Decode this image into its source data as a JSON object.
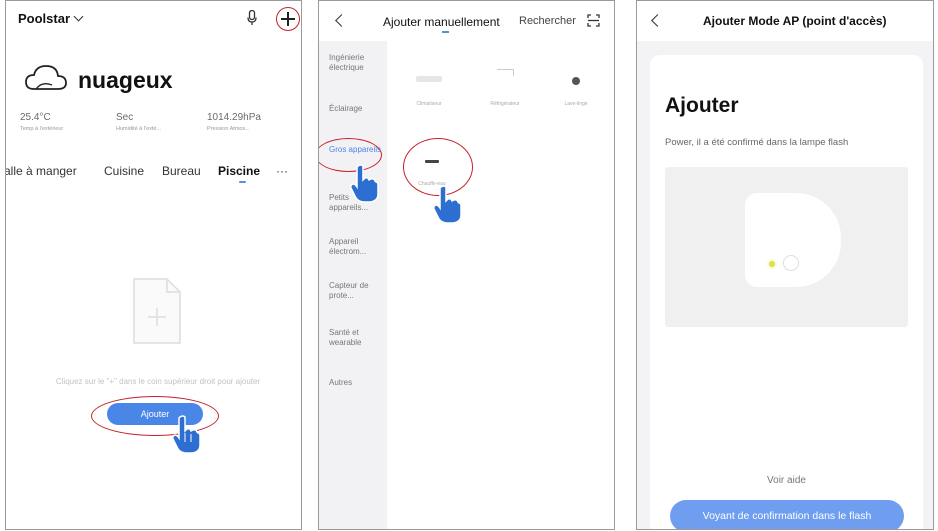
{
  "panel1": {
    "home_name": "Poolstar",
    "weather": {
      "condition": "nuageux",
      "temperature": "25.4°C",
      "temperature_label": "Temp à l'extérieur",
      "humidity": "Sec",
      "humidity_label": "Humidité à l'exté...",
      "pressure": "1014.29hPa",
      "pressure_label": "Pression Atmos..."
    },
    "rooms": [
      "alle à manger",
      "Cuisine",
      "Bureau",
      "Piscine"
    ],
    "active_room": "Piscine",
    "more": "···",
    "empty_hint": "Cliquez sur le \"+\" dans le coin supérieur droit pour ajouter",
    "add_button": "Ajouter"
  },
  "panel2": {
    "title": "Ajouter manuellement",
    "search": "Rechercher",
    "categories": [
      {
        "label": "Ingénierie électrique",
        "active": false
      },
      {
        "label": "Éclairage",
        "active": false
      },
      {
        "label": "Gros appareils",
        "active": true
      },
      {
        "label": "Petits appareils...",
        "active": false
      },
      {
        "label": "Appareil électrom...",
        "active": false
      },
      {
        "label": "Capteur de prote...",
        "active": false
      },
      {
        "label": "Santé et wearable",
        "active": false
      },
      {
        "label": "Autres",
        "active": false
      }
    ],
    "devices": [
      "Climatiseur",
      "Réfrigérateur",
      "Lave-linge",
      "Chauffe-eau"
    ]
  },
  "panel3": {
    "title": "Ajouter",
    "mode": "Mode AP (point d'accès)",
    "heading": "Ajouter",
    "subtitle": "Power, il a été confirmé dans la lampe flash",
    "help": "Voir aide",
    "confirm_button": "Voyant de confirmation dans le flash"
  },
  "colors": {
    "accent": "#4a85e8",
    "highlight_ring": "#c8202a",
    "led": "#d8e24a"
  },
  "icons": [
    "chevron-down-icon",
    "microphone-icon",
    "plus-icon",
    "cloud-icon",
    "document-icon",
    "back-arrow-icon",
    "scan-icon",
    "hand-pointer-icon"
  ]
}
